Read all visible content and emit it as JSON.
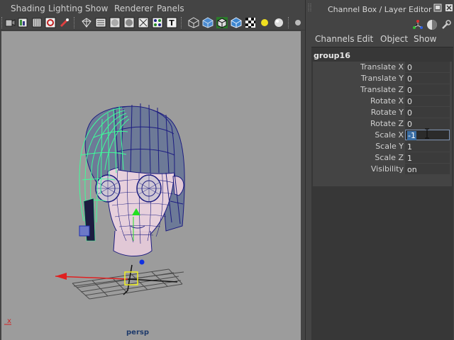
{
  "viewport": {
    "menus": [
      "Shading",
      "Lighting",
      "Show",
      "Renderer",
      "Panels"
    ],
    "camera_label": "persp",
    "axis_label": "x",
    "toolbar_icons": [
      "select-camera-icon",
      "camera-attributes-icon",
      "bookmarks-icon",
      "image-plane-icon",
      "two-d-pan-icon",
      "wireframe-icon",
      "smooth-shade-icon",
      "flat-shade-icon",
      "bounding-box-icon",
      "points-icon",
      "textured-icon",
      "xray-icon",
      "shaded-icon",
      "wireframe-on-shaded-icon",
      "backface-icon",
      "checker-icon",
      "light-icon",
      "shadow-icon"
    ]
  },
  "channel_box": {
    "title": "Channel Box / Layer Editor",
    "menus": [
      "Channels",
      "Edit",
      "Object",
      "Show"
    ],
    "object_name": "group16",
    "attributes": [
      {
        "label": "Translate X",
        "value": "0"
      },
      {
        "label": "Translate Y",
        "value": "0"
      },
      {
        "label": "Translate Z",
        "value": "0"
      },
      {
        "label": "Rotate X",
        "value": "0"
      },
      {
        "label": "Rotate Y",
        "value": "0"
      },
      {
        "label": "Rotate Z",
        "value": "0"
      },
      {
        "label": "Scale X",
        "value": "-1"
      },
      {
        "label": "Scale Y",
        "value": "1"
      },
      {
        "label": "Scale Z",
        "value": "1"
      },
      {
        "label": "Visibility",
        "value": "on"
      }
    ]
  },
  "colors": {
    "ui_background": "#444444",
    "viewport_background": "#9c9c9c",
    "selection_wireframe": "#3dff9a",
    "mesh_wireframe": "#1c1c80",
    "skin_shade": "#e7d0dc",
    "hair_shade": "#6d7a97"
  }
}
